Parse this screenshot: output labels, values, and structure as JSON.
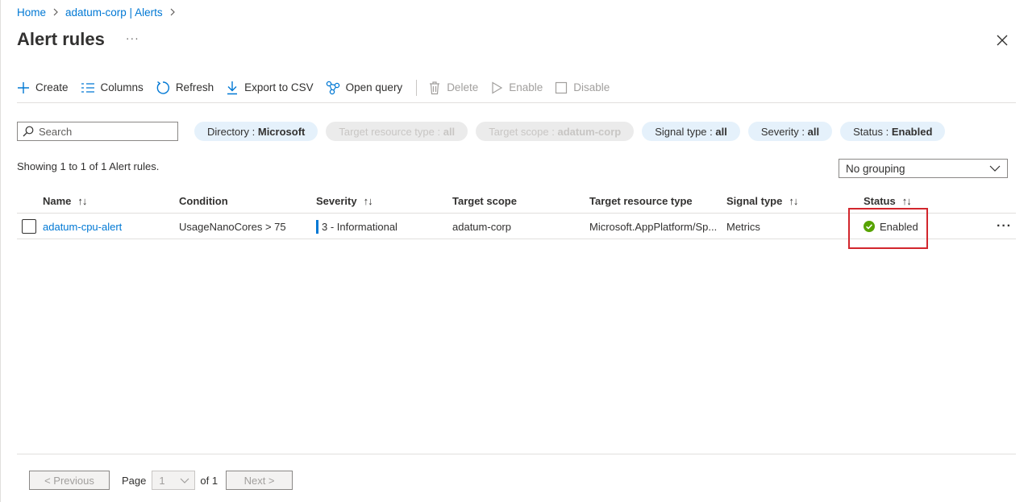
{
  "breadcrumb": {
    "items": [
      "Home",
      "adatum-corp | Alerts"
    ]
  },
  "page": {
    "title": "Alert rules",
    "more": "···"
  },
  "toolbar": {
    "create": "Create",
    "columns": "Columns",
    "refresh": "Refresh",
    "export": "Export to CSV",
    "open_query": "Open query",
    "delete": "Delete",
    "enable": "Enable",
    "disable": "Disable"
  },
  "filters": {
    "search_placeholder": "Search",
    "pills": [
      {
        "label": "Directory : ",
        "value": "Microsoft",
        "disabled": false
      },
      {
        "label": "Target resource type : ",
        "value": "all",
        "disabled": true
      },
      {
        "label": "Target scope : ",
        "value": "adatum-corp",
        "disabled": true
      },
      {
        "label": "Signal type : ",
        "value": "all",
        "disabled": false
      },
      {
        "label": "Severity : ",
        "value": "all",
        "disabled": false
      },
      {
        "label": "Status : ",
        "value": "Enabled",
        "disabled": false
      }
    ]
  },
  "summary": {
    "showing": "Showing 1 to 1 of 1 Alert rules."
  },
  "grouping": {
    "selected": "No grouping"
  },
  "table": {
    "columns": [
      "Name",
      "Condition",
      "Severity",
      "Target scope",
      "Target resource type",
      "Signal type",
      "Status"
    ],
    "sort_icon": "↑↓",
    "rows": [
      {
        "name": "adatum-cpu-alert",
        "condition": "UsageNanoCores > 75",
        "severity": "3 - Informational",
        "target_scope": "adatum-corp",
        "target_resource_type": "Microsoft.AppPlatform/Sp...",
        "signal_type": "Metrics",
        "status": "Enabled",
        "more": "···"
      }
    ]
  },
  "pager": {
    "previous": "< Previous",
    "page_label": "Page",
    "page_value": "1",
    "of_label": "of 1",
    "next": "Next >"
  },
  "colors": {
    "accent": "#0078d4",
    "pill_bg": "#e5f1fb",
    "status_ok": "#57a300",
    "highlight": "#d2262d"
  }
}
